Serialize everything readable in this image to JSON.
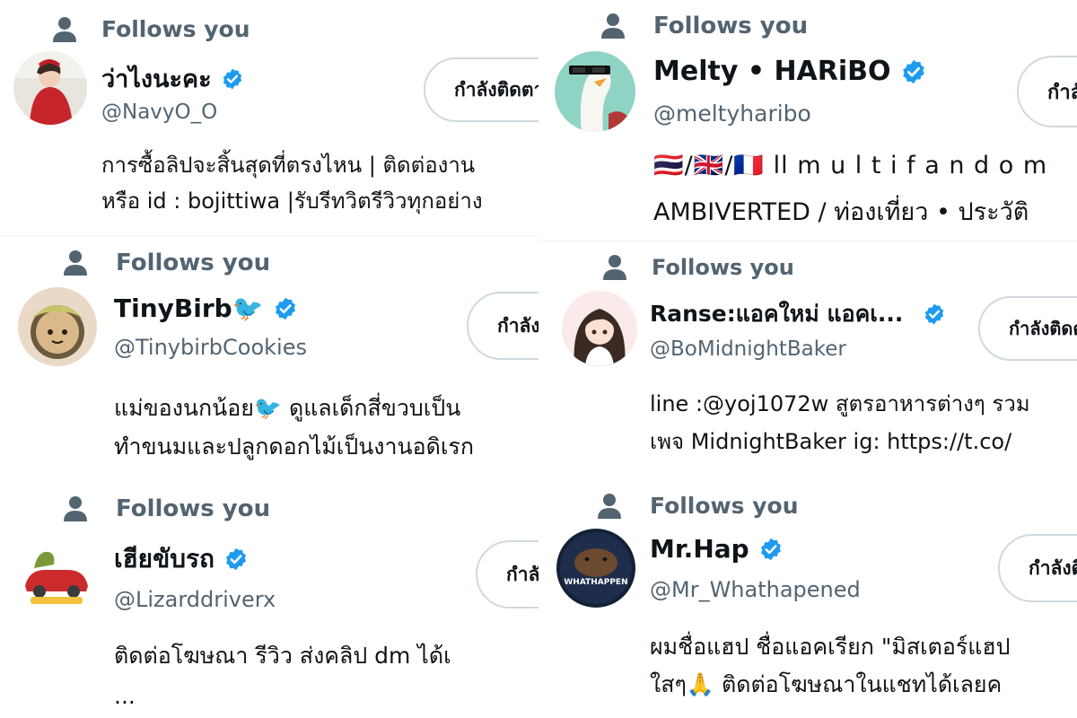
{
  "follows_label": "Follows you",
  "follow_button_label": "กำลังติดตาม",
  "colors": {
    "verified": "#1d9bf0",
    "secondary_text": "#536471",
    "border": "#cfd9de"
  },
  "accounts": [
    {
      "name": "ว่าไงนะคะ",
      "handle": "@NavyO_O",
      "verified": true,
      "bio": [
        "การซื้อลิปจะสิ้นสุดที่ตรงไหน | ติดต่องาน",
        "หรือ id : bojittiwa |รับรีทวิตรีวิวทุกอย่าง"
      ],
      "avatar": "woman-red-sweater-photo"
    },
    {
      "name": "TinyBirb🐦",
      "handle": "@TinybirbCookies",
      "verified": true,
      "bio": [
        "แม่ของนกน้อย🐦 ดูแลเด็กสี่ขวบเป็น",
        "ทำขนมและปลูกดอกไม้เป็นงานอดิเรก"
      ],
      "avatar": "cookie-character-photo"
    },
    {
      "name": "เฮียขับรถ",
      "handle": "@Lizarddriverx",
      "verified": true,
      "bio": [
        "ติดต่อโฆษณา รีวิว ส่งคลิป dm ได้เ",
        "..."
      ],
      "avatar": "lizard-car-logo"
    },
    {
      "name": "Melty • HARiBO",
      "handle": "@meltyharibo",
      "verified": true,
      "bio": [
        "🇹🇭/🇬🇧/🇫🇷 ll m u l t i f a n d o m",
        "AMBIVERTED / ท่องเที่ยว • ประวัติ"
      ],
      "avatar": "goose-sunglasses-avatar"
    },
    {
      "name": "Ranse:แอคใหม่ แอคเ...",
      "handle": "@BoMidnightBaker",
      "verified": true,
      "bio": [
        "line :@yoj1072w สูตรอาหารต่างๆ รวม",
        "เพจ MidnightBaker ig: https://t.co/"
      ],
      "avatar": "anime-girl-avatar"
    },
    {
      "name": "Mr.Hap",
      "handle": "@Mr_Whathapened",
      "verified": true,
      "bio": [
        "ผมชื่อแฮป ชื่อแอคเรียก \"มิสเตอร์แฮป",
        "ใสๆ🙏 ติดต่อโฆษณาในแชทได้เลยค"
      ],
      "avatar": "capybara-whathappen-logo",
      "avatar_text": "WHATHAPPEN"
    }
  ]
}
